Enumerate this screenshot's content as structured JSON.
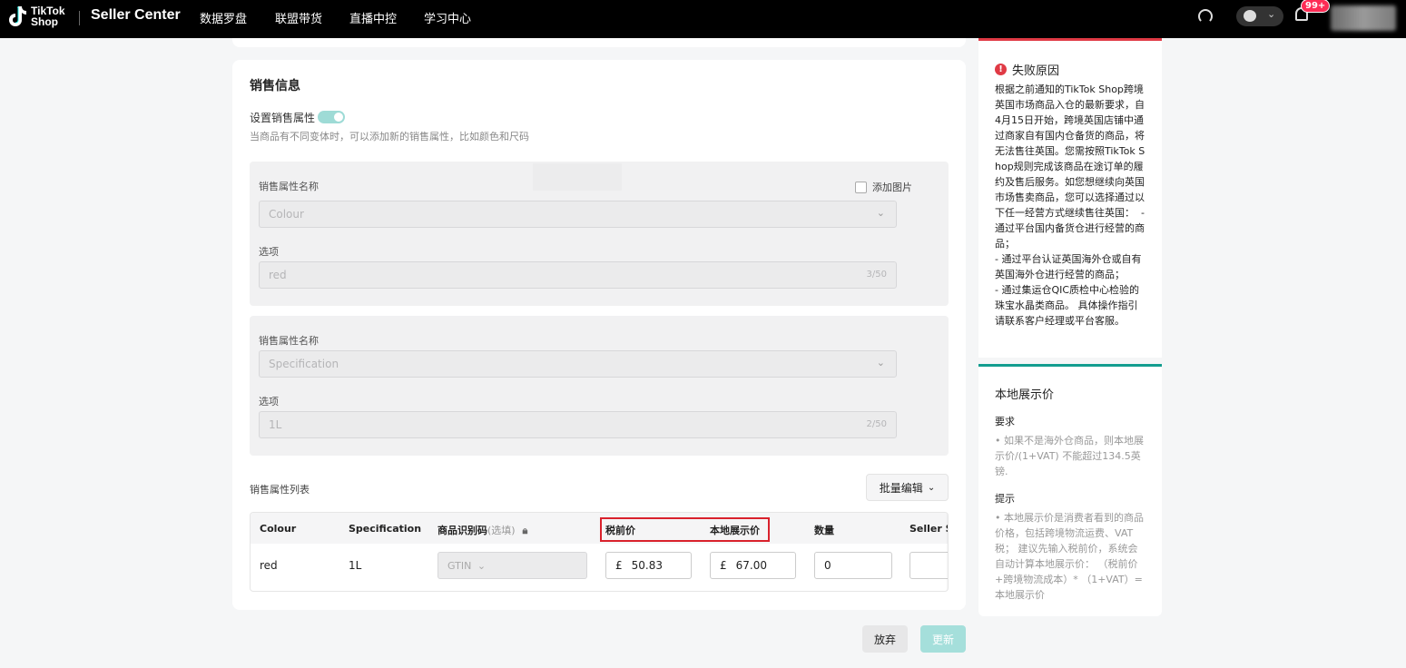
{
  "header": {
    "logo_line1": "TikTok",
    "logo_line2": "Shop",
    "brand": "Seller Center",
    "nav": [
      "数据罗盘",
      "联盟带货",
      "直播中控",
      "学习中心"
    ],
    "notification_badge": "99+"
  },
  "sales": {
    "title": "销售信息",
    "toggle_label": "设置销售属性",
    "toggle_on": true,
    "hint": "当商品有不同变体时，可以添加新的销售属性，比如颜色和尺码",
    "attributes": [
      {
        "name_label": "销售属性名称",
        "name_value": "Colour",
        "add_image_label": "添加图片",
        "option_label": "选项",
        "option_value": "red",
        "option_count": "3/50"
      },
      {
        "name_label": "销售属性名称",
        "name_value": "Specification",
        "option_label": "选项",
        "option_value": "1L",
        "option_count": "2/50"
      }
    ],
    "list_title": "销售属性列表",
    "batch_edit": "批量编辑",
    "table": {
      "headers": {
        "colour": "Colour",
        "spec": "Specification",
        "id_code": "商品识别码",
        "id_code_optional": "(选填)",
        "pretax": "税前价",
        "local_price": "本地展示价",
        "qty": "数量",
        "seller_sku": "Seller SK"
      },
      "row": {
        "colour": "red",
        "spec": "1L",
        "gtin": "GTIN",
        "currency": "£",
        "pretax": "50.83",
        "local_price": "67.00",
        "qty": "0"
      }
    }
  },
  "actions": {
    "discard": "放弃",
    "update": "更新"
  },
  "fail_panel": {
    "title": "失败原因",
    "body": "根据之前通知的TikTok Shop跨境英国市场商品入仓的最新要求，自4月15日开始，跨境英国店铺中通过商家自有国内仓备货的商品，将无法售往英国。您需按照TikTok Shop规则完成该商品在途订单的履约及售后服务。如您想继续向英国市场售卖商品，您可以选择通过以下任一经营方式继续售往英国：  - 通过平台国内备货仓进行经营的商品；\n- 通过平台认证英国海外仓或自有英国海外仓进行经营的商品；\n- 通过集运仓QIC质检中心检验的珠宝水晶类商品。 具体操作指引请联系客户经理或平台客服。"
  },
  "local_panel": {
    "title": "本地展示价",
    "req_title": "要求",
    "req_body": "• 如果不是海外仓商品，则本地展示价/(1+VAT) 不能超过134.5英镑.",
    "tip_title": "提示",
    "tip_body": "• 本地展示价是消费者看到的商品价格，包括跨境物流运费、VAT税； 建议先输入税前价，系统会自动计算本地展示价： （税前价+跨境物流成本）* （1+VAT）=本地展示价"
  },
  "colors": {
    "accent": "#139d8f",
    "error": "#e03a45",
    "highlight_border": "#d9212c",
    "badge": "#fe2c55"
  }
}
